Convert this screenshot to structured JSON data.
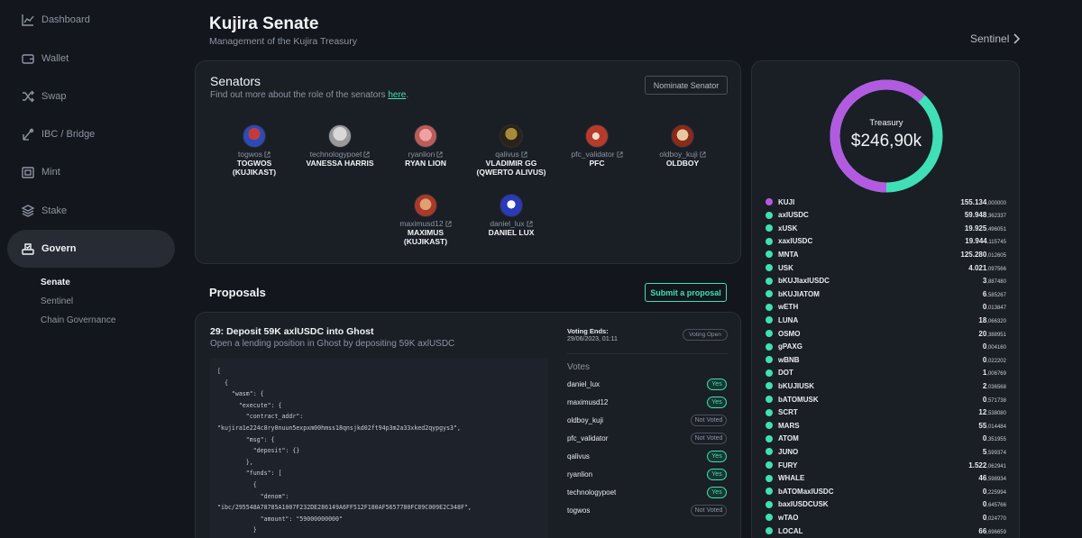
{
  "sidebar": {
    "items": [
      {
        "label": "Dashboard",
        "icon": "chart-line-icon"
      },
      {
        "label": "Wallet",
        "icon": "wallet-icon"
      },
      {
        "label": "Swap",
        "icon": "shuffle-icon"
      },
      {
        "label": "IBC / Bridge",
        "icon": "bridge-icon"
      },
      {
        "label": "Mint",
        "icon": "mint-icon"
      },
      {
        "label": "Stake",
        "icon": "layers-icon"
      },
      {
        "label": "Govern",
        "icon": "govern-icon"
      }
    ],
    "active": "Govern",
    "subitems": [
      {
        "label": "Senate"
      },
      {
        "label": "Sentinel"
      },
      {
        "label": "Chain Governance"
      }
    ]
  },
  "header": {
    "title": "Kujira Senate",
    "subtitle": "Management of the Kujira Treasury",
    "sentinel_link": "Sentinel"
  },
  "senators": {
    "title": "Senators",
    "subtitle_prefix": "Find out more about the role of the senators ",
    "subtitle_link": "here",
    "subtitle_suffix": ".",
    "nominate_label": "Nominate Senator",
    "list": [
      {
        "handle": "togwos",
        "name": "TOGWOS",
        "name2": "(KUJIKAST)"
      },
      {
        "handle": "technologypoet",
        "name": "VANESSA HARRIS",
        "name2": ""
      },
      {
        "handle": "ryanlion",
        "name": "RYAN LION",
        "name2": ""
      },
      {
        "handle": "qalivus",
        "name": "VLADIMIR GG",
        "name2": "(QWERTO ALIVUS)"
      },
      {
        "handle": "pfc_validator",
        "name": "PFC",
        "name2": ""
      },
      {
        "handle": "oldboy_kuji",
        "name": "OLDBOY",
        "name2": ""
      },
      {
        "handle": "maximusd12",
        "name": "MAXIMUS",
        "name2": "(KUJIKAST)"
      },
      {
        "handle": "daniel_lux",
        "name": "DANIEL LUX",
        "name2": ""
      }
    ]
  },
  "proposals": {
    "title": "Proposals",
    "submit_label": "Submit a proposal",
    "items": [
      {
        "title": "29: Deposit 59K axlUSDC into Ghost",
        "description": "Open a lending position in Ghost by depositing 59K axlUSDC",
        "code": "[\n  {\n    \"wasm\": {\n      \"execute\": {\n        \"contract_addr\":\n\"kujira1e224c8ry0nuun5expxm00hmss18qnsjkd02ft94p3m2a33xked2qypgys3\",\n        \"msg\": {\n          \"deposit\": {}\n        },\n        \"funds\": [\n          {\n            \"denom\":\n\"ibc/295548A78785A1007F232DE286149A6FF512F180AF5657780FC89C009E2C348F\",\n            \"amount\": \"59000000000\"\n          }\n        ]\n      }\n    }",
        "voting_ends_label": "Voting Ends:",
        "voting_ends_date": "29/06/2023, 01:11",
        "status": "Voting Open",
        "votes_title": "Votes",
        "votes": [
          {
            "voter": "daniel_lux",
            "vote": "Yes"
          },
          {
            "voter": "maximusd12",
            "vote": "Yes"
          },
          {
            "voter": "oldboy_kuji",
            "vote": "Not Voted"
          },
          {
            "voter": "pfc_validator",
            "vote": "Not Voted"
          },
          {
            "voter": "qalivus",
            "vote": "Yes"
          },
          {
            "voter": "ryanlion",
            "vote": "Yes"
          },
          {
            "voter": "technologypoet",
            "vote": "Yes"
          },
          {
            "voter": "togwos",
            "vote": "Not Voted"
          }
        ]
      }
    ]
  },
  "treasury": {
    "label": "Treasury",
    "total": "$246,90k",
    "ring_colors": {
      "primary": "#b25be0",
      "secondary": "#3fe0b6"
    },
    "ring_primary_fraction": 0.62,
    "assets": [
      {
        "name": "KUJI",
        "int": "155.134",
        "dec": ",000000",
        "color": "#b25be0"
      },
      {
        "name": "axlUSDC",
        "int": "59.948",
        "dec": ",362337",
        "color": "#3fe0b6"
      },
      {
        "name": "xUSK",
        "int": "19.925",
        "dec": ",496051",
        "color": "#3fe0b6"
      },
      {
        "name": "xaxlUSDC",
        "int": "19.944",
        "dec": ",115745",
        "color": "#3fe0b6"
      },
      {
        "name": "MNTA",
        "int": "125.280",
        "dec": ",012605",
        "color": "#3fe0b6"
      },
      {
        "name": "USK",
        "int": "4.021",
        "dec": ",097566",
        "color": "#3fe0b6"
      },
      {
        "name": "bKUJIaxlUSDC",
        "int": "3",
        "dec": ",887480",
        "color": "#3fe0b6"
      },
      {
        "name": "bKUJIATOM",
        "int": "6",
        "dec": ",585267",
        "color": "#3fe0b6"
      },
      {
        "name": "wETH",
        "int": "0",
        "dec": ",013847",
        "color": "#3fe0b6"
      },
      {
        "name": "LUNA",
        "int": "18",
        "dec": ",066320",
        "color": "#3fe0b6"
      },
      {
        "name": "OSMO",
        "int": "20",
        "dec": ",388951",
        "color": "#3fe0b6"
      },
      {
        "name": "gPAXG",
        "int": "0",
        "dec": ",004160",
        "color": "#3fe0b6"
      },
      {
        "name": "wBNB",
        "int": "0",
        "dec": ",022202",
        "color": "#3fe0b6"
      },
      {
        "name": "DOT",
        "int": "1",
        "dec": ",006769",
        "color": "#3fe0b6"
      },
      {
        "name": "bKUJIUSK",
        "int": "2",
        "dec": ",036568",
        "color": "#3fe0b6"
      },
      {
        "name": "bATOMUSK",
        "int": "0",
        "dec": ",571738",
        "color": "#3fe0b6"
      },
      {
        "name": "SCRT",
        "int": "12",
        "dec": ",538080",
        "color": "#3fe0b6"
      },
      {
        "name": "MARS",
        "int": "55",
        "dec": ",014484",
        "color": "#3fe0b6"
      },
      {
        "name": "ATOM",
        "int": "0",
        "dec": ",351955",
        "color": "#3fe0b6"
      },
      {
        "name": "JUNO",
        "int": "5",
        "dec": ",599374",
        "color": "#3fe0b6"
      },
      {
        "name": "FURY",
        "int": "1.522",
        "dec": ",062941",
        "color": "#3fe0b6"
      },
      {
        "name": "WHALE",
        "int": "46",
        "dec": ",598934",
        "color": "#3fe0b6"
      },
      {
        "name": "bATOMaxlUSDC",
        "int": "0",
        "dec": ",225994",
        "color": "#3fe0b6"
      },
      {
        "name": "baxlUSDCUSK",
        "int": "0",
        "dec": ",645766",
        "color": "#3fe0b6"
      },
      {
        "name": "wTAO",
        "int": "0",
        "dec": ",024770",
        "color": "#3fe0b6"
      },
      {
        "name": "LOCAL",
        "int": "66",
        "dec": ",696659",
        "color": "#3fe0b6"
      }
    ]
  }
}
